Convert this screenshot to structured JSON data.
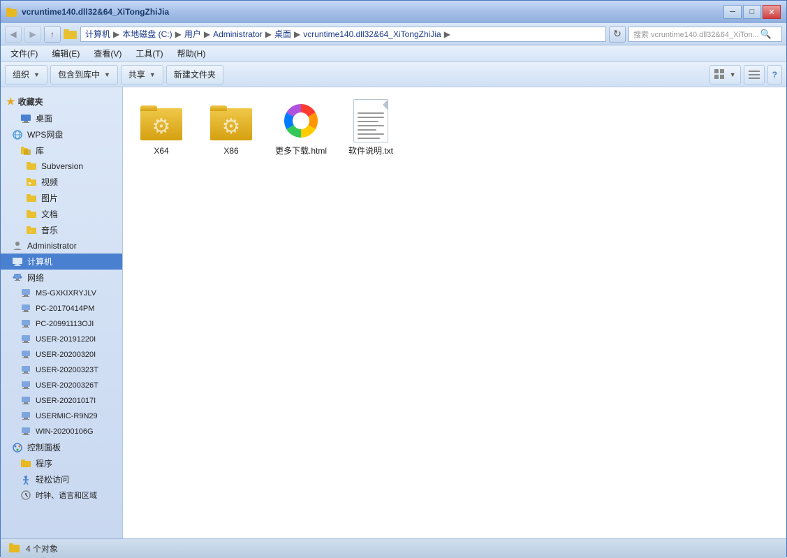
{
  "window": {
    "title": "vcruntime140.dll32&64_XiTongZhiJia",
    "controls": {
      "minimize": "─",
      "maximize": "□",
      "close": "✕"
    }
  },
  "addressBar": {
    "breadcrumbs": [
      "计算机",
      "本地磁盘 (C:)",
      "用户",
      "Administrator",
      "桌面",
      "vcruntime140.dll32&64_XiTongZhiJia"
    ],
    "searchPlaceholder": "搜索 vcruntime140.dll32&64_XiTon..."
  },
  "menuBar": {
    "items": [
      "文件(F)",
      "编辑(E)",
      "查看(V)",
      "工具(T)",
      "帮助(H)"
    ]
  },
  "toolbar": {
    "items": [
      "组织",
      "包含到库中",
      "共享",
      "新建文件夹"
    ]
  },
  "sidebar": {
    "favorites": {
      "label": "收藏夹",
      "items": [
        "桌面"
      ]
    },
    "wps": {
      "label": "WPS网盘"
    },
    "library": {
      "label": "库",
      "items": [
        "Subversion",
        "视频",
        "图片",
        "文档",
        "音乐"
      ]
    },
    "administrator": {
      "label": "Administrator"
    },
    "computer": {
      "label": "计算机",
      "active": true
    },
    "network": {
      "label": "网络",
      "items": [
        "MS-GXKIXRYJLV",
        "PC-20170414PM",
        "PC-20991113OJI",
        "USER-20191220I",
        "USER-20200320I",
        "USER-20200323T",
        "USER-20200326T",
        "USER-20201017I",
        "USERMIC-R9N29",
        "WIN-20200106G"
      ]
    },
    "controlPanel": {
      "label": "控制面板",
      "items": [
        "程序",
        "轻松访问",
        "时钟、语言和区域"
      ]
    }
  },
  "files": [
    {
      "name": "X64",
      "type": "folder-gear",
      "label": "X64"
    },
    {
      "name": "X86",
      "type": "folder-gear",
      "label": "X86"
    },
    {
      "name": "更多下载.html",
      "type": "html-colorwheel",
      "label": "更多下载.html"
    },
    {
      "name": "软件说明.txt",
      "type": "txt",
      "label": "软件说明.txt"
    }
  ],
  "statusBar": {
    "text": "4 个对象"
  }
}
